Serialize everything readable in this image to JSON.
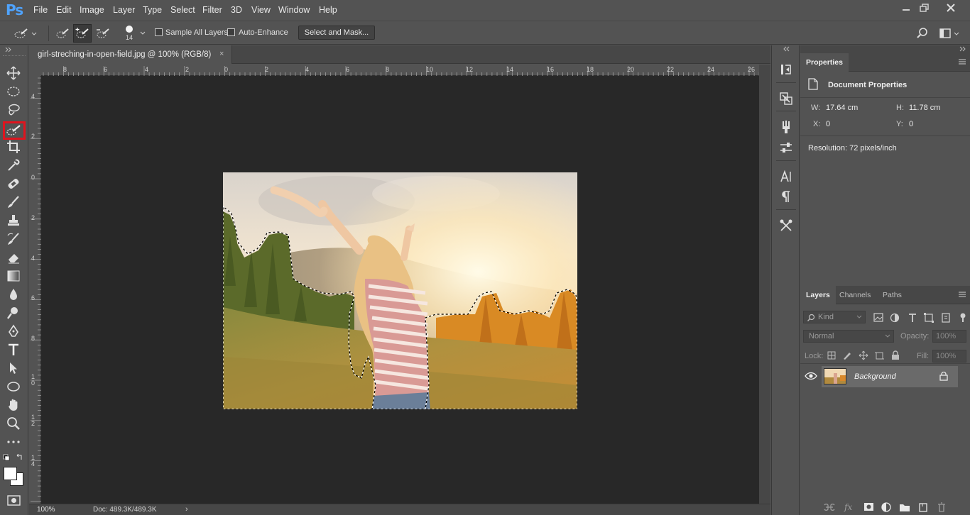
{
  "app": {
    "logo": "Ps",
    "menu": [
      "File",
      "Edit",
      "Image",
      "Layer",
      "Type",
      "Select",
      "Filter",
      "3D",
      "View",
      "Window",
      "Help"
    ],
    "window_controls": [
      "minimize",
      "restore",
      "close"
    ]
  },
  "options_bar": {
    "brush_size": "14",
    "sample_all_layers_label": "Sample All Layers",
    "sample_all_layers_checked": false,
    "auto_enhance_label": "Auto-Enhance",
    "auto_enhance_checked": false,
    "select_and_mask_label": "Select and Mask..."
  },
  "toolbar": {
    "active_tool": "quick-selection-tool",
    "tools": [
      "move-tool",
      "marquee-tool",
      "lasso-tool",
      "quick-selection-tool",
      "crop-tool",
      "eyedropper-tool",
      "healing-brush-tool",
      "brush-tool",
      "clone-stamp-tool",
      "history-brush-tool",
      "eraser-tool",
      "gradient-tool",
      "blur-tool",
      "dodge-tool",
      "pen-tool",
      "type-tool",
      "path-selection-tool",
      "ellipse-tool",
      "hand-tool",
      "zoom-tool",
      "more-tools"
    ]
  },
  "document": {
    "tab_title": "girl-streching-in-open-field.jpg @ 100% (RGB/8)",
    "close_glyph": "×",
    "ruler_top_labels": [
      "8",
      "6",
      "4",
      "2",
      "0",
      "2",
      "4",
      "6",
      "8",
      "10",
      "12",
      "14",
      "16",
      "18",
      "20",
      "22",
      "24",
      "26"
    ],
    "ruler_left_labels": [
      "4",
      "2",
      "0",
      "2",
      "4",
      "6",
      "8",
      "1\n0",
      "1\n2",
      "1\n4"
    ]
  },
  "status_bar": {
    "zoom": "100%",
    "doc_size": "Doc: 489.3K/489.3K",
    "arrow": "›"
  },
  "properties_panel": {
    "tab_label": "Properties",
    "section_title": "Document Properties",
    "w_label": "W:",
    "w_value": "17.64 cm",
    "h_label": "H:",
    "h_value": "11.78 cm",
    "x_label": "X:",
    "x_value": "0",
    "y_label": "Y:",
    "y_value": "0",
    "resolution": "Resolution: 72 pixels/inch"
  },
  "layers_panel": {
    "tabs": [
      "Layers",
      "Channels",
      "Paths"
    ],
    "active_tab": "Layers",
    "filter_placeholder": "Kind",
    "blend_mode": "Normal",
    "opacity_label": "Opacity:",
    "opacity_value": "100%",
    "lock_label": "Lock:",
    "fill_label": "Fill:",
    "fill_value": "100%",
    "layers": [
      {
        "name": "Background",
        "visible": true,
        "locked": true
      }
    ]
  },
  "colors": {
    "accent_selection": "#e0141e",
    "ps_blue": "#4fa3ff"
  }
}
